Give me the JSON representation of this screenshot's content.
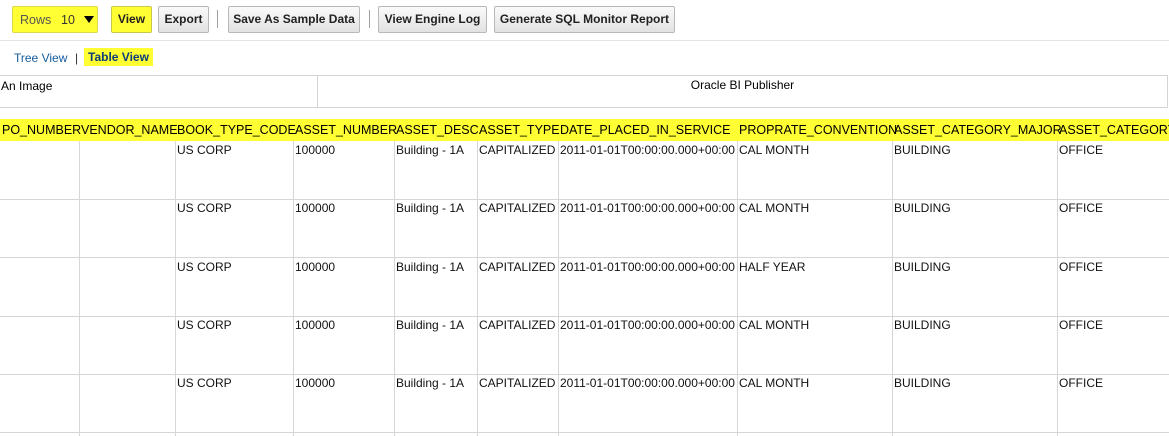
{
  "toolbar": {
    "rows_label": "Rows",
    "rows_value": "10",
    "buttons": {
      "view": "View",
      "export": "Export",
      "save_sample": "Save As Sample Data",
      "engine_log": "View Engine Log",
      "sql_monitor": "Generate SQL Monitor Report"
    }
  },
  "view_tabs": {
    "tree": "Tree View",
    "separator": "|",
    "table": "Table View"
  },
  "report_header": {
    "image_alt": "An Image",
    "publisher": "Oracle BI Publisher"
  },
  "table": {
    "columns": [
      "PO_NUMBER",
      "VENDOR_NAME",
      "BOOK_TYPE_CODE",
      "ASSET_NUMBER",
      "ASSET_DESC",
      "ASSET_TYPE",
      "DATE_PLACED_IN_SERVICE",
      "PROPRATE_CONVENTION",
      "ASSET_CATEGORY_MAJOR",
      "ASSET_CATEGORY"
    ],
    "rows": [
      [
        "",
        "",
        "US CORP",
        "100000",
        "Building - 1A",
        "CAPITALIZED",
        "2011-01-01T00:00:00.000+00:00",
        "CAL MONTH",
        "BUILDING",
        "OFFICE"
      ],
      [
        "",
        "",
        "US CORP",
        "100000",
        "Building - 1A",
        "CAPITALIZED",
        "2011-01-01T00:00:00.000+00:00",
        "CAL MONTH",
        "BUILDING",
        "OFFICE"
      ],
      [
        "",
        "",
        "US CORP",
        "100000",
        "Building - 1A",
        "CAPITALIZED",
        "2011-01-01T00:00:00.000+00:00",
        "HALF YEAR",
        "BUILDING",
        "OFFICE"
      ],
      [
        "",
        "",
        "US CORP",
        "100000",
        "Building - 1A",
        "CAPITALIZED",
        "2011-01-01T00:00:00.000+00:00",
        "CAL MONTH",
        "BUILDING",
        "OFFICE"
      ],
      [
        "",
        "",
        "US CORP",
        "100000",
        "Building - 1A",
        "CAPITALIZED",
        "2011-01-01T00:00:00.000+00:00",
        "CAL MONTH",
        "BUILDING",
        "OFFICE"
      ]
    ]
  },
  "colors": {
    "highlight": "#ffff33",
    "link": "#145c9e",
    "grid_line": "#d6d6d6"
  },
  "icons": {
    "rows_dropdown": "caret-down-icon"
  }
}
